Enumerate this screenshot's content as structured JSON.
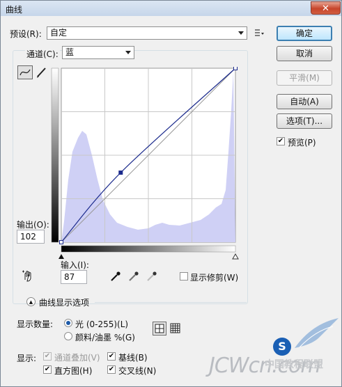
{
  "window": {
    "title": "曲线",
    "close_glyph": "✕"
  },
  "preset": {
    "label": "预设(R):",
    "value": "自定",
    "menu_icon": "preset-options-icon"
  },
  "buttons": {
    "ok": "确定",
    "cancel": "取消",
    "smooth": "平滑(M)",
    "auto": "自动(A)",
    "options": "选项(T)..."
  },
  "preview": {
    "label": "预览(P)",
    "checked": true
  },
  "channel": {
    "label": "通道(C):",
    "value": "蓝"
  },
  "tools": {
    "curve_tool": "curve-point-tool-icon",
    "pencil_tool": "pencil-icon",
    "hand_tool": "target-adjust-hand-icon"
  },
  "output": {
    "label": "输出(O):",
    "value": "102"
  },
  "input": {
    "label": "输入(I):",
    "value": "87"
  },
  "eyedroppers": [
    "black-point-eyedropper-icon",
    "gray-point-eyedropper-icon",
    "white-point-eyedropper-icon"
  ],
  "show_clipping": {
    "label": "显示修剪(W)",
    "checked": false
  },
  "display_options": {
    "title": "曲线显示选项",
    "toggle_glyph": "▲"
  },
  "show_amount": {
    "label": "显示数量:",
    "options": [
      {
        "label": "光 (0-255)(L)",
        "selected": true
      },
      {
        "label": "颜料/油墨 %(G)",
        "selected": false
      }
    ],
    "grid_icons": [
      "grid-coarse-icon",
      "grid-fine-icon"
    ]
  },
  "show": {
    "label": "显示:",
    "items": [
      {
        "label": "通道叠加(V)",
        "checked": true,
        "disabled": true
      },
      {
        "label": "基线(B)",
        "checked": true,
        "disabled": false
      },
      {
        "label": "直方图(H)",
        "checked": true,
        "disabled": false
      },
      {
        "label": "交叉线(N)",
        "checked": true,
        "disabled": false
      }
    ]
  },
  "curve": {
    "points": [
      [
        0,
        0
      ],
      [
        87,
        102
      ],
      [
        255,
        255
      ]
    ],
    "colors": {
      "curve": "#1b2a8c",
      "histogram": "#cfd0f5",
      "point": "#1b2a8c"
    }
  },
  "watermark": {
    "text": "JCWcn.com",
    "brand": "中国教程联盟",
    "badge": "S"
  }
}
